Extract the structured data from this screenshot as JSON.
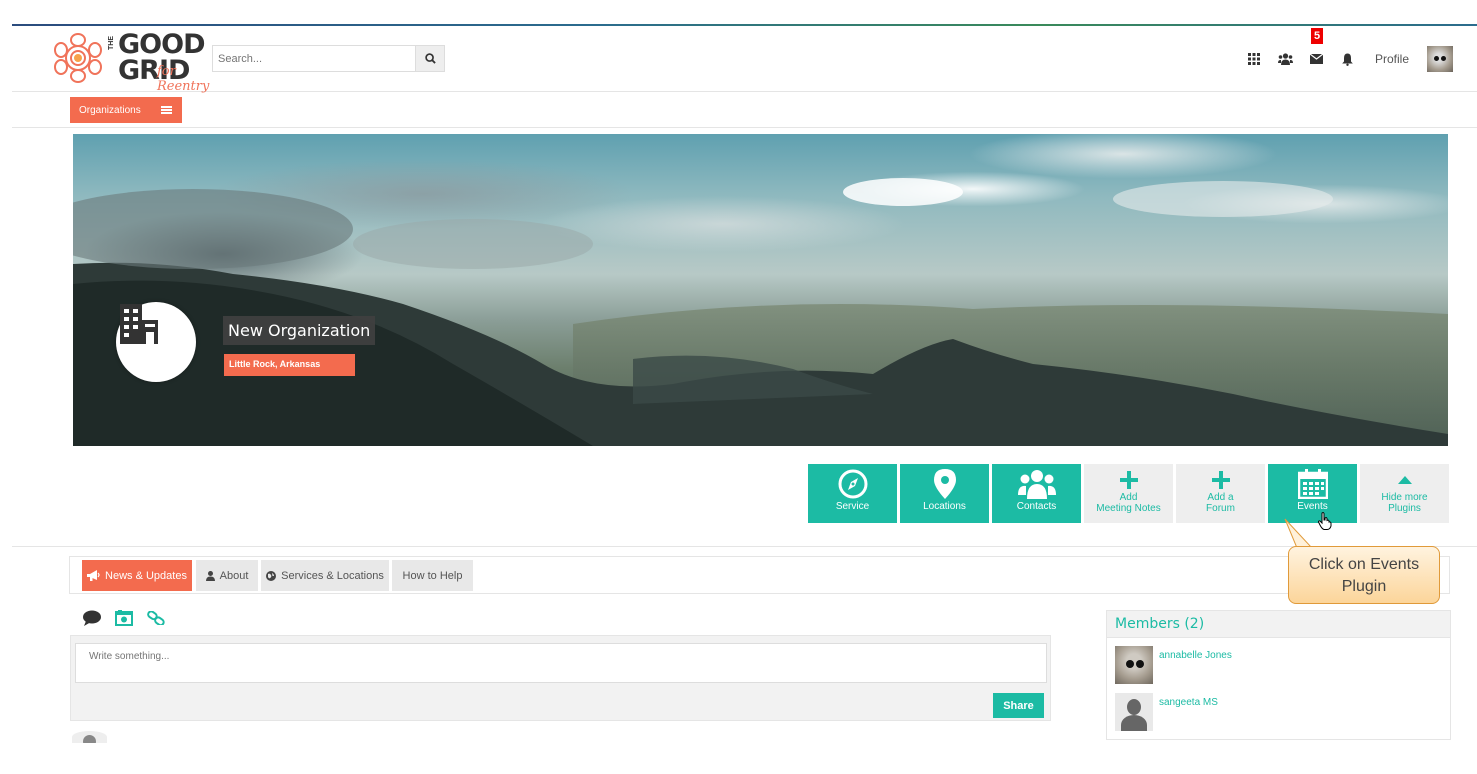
{
  "app": {
    "logo_text_line1": "GOOD",
    "logo_text_line2": "GRID",
    "logo_the": "THE",
    "logo_script": "for Reentry"
  },
  "search": {
    "placeholder": "Search...",
    "icon": "search-icon"
  },
  "topnav": {
    "icons": [
      "apps-grid-icon",
      "users-icon",
      "envelope-icon",
      "bell-icon"
    ],
    "mail_badge": "5",
    "profile_label": "Profile"
  },
  "subnav": {
    "organizations_label": "Organizations"
  },
  "organization": {
    "name": "New Organization",
    "location": "Little Rock, Arkansas"
  },
  "plugins": [
    {
      "label": "Service",
      "icon": "compass-icon",
      "style": "teal"
    },
    {
      "label": "Locations",
      "icon": "map-marker-icon",
      "style": "teal"
    },
    {
      "label": "Contacts",
      "icon": "users-icon",
      "style": "teal"
    },
    {
      "label": "Add Meeting Notes",
      "line1": "Add",
      "line2": "Meeting Notes",
      "icon": "plus-icon",
      "style": "grey"
    },
    {
      "label": "Add a Forum",
      "line1": "Add a",
      "line2": "Forum",
      "icon": "plus-icon",
      "style": "grey"
    },
    {
      "label": "Events",
      "icon": "calendar-icon",
      "style": "teal"
    },
    {
      "label": "Hide more Plugins",
      "line1": "Hide more",
      "line2": "Plugins",
      "icon": "caret-up-icon",
      "style": "grey"
    }
  ],
  "tabs": [
    {
      "label": "News & Updates",
      "icon": "bullhorn-icon",
      "active": true
    },
    {
      "label": "About",
      "icon": "user-icon",
      "active": false
    },
    {
      "label": "Services & Locations",
      "icon": "globe-icon",
      "active": false
    },
    {
      "label": "How to Help",
      "icon": "",
      "active": false
    }
  ],
  "callout": {
    "line1": "Click on Events",
    "line2": "Plugin"
  },
  "post": {
    "placeholder": "Write something...",
    "share_label": "Share",
    "type_icons": [
      "comment-icon",
      "photo-icon",
      "link-icon"
    ]
  },
  "members": {
    "title": "Members (2)",
    "list": [
      {
        "name": "annabelle Jones"
      },
      {
        "name": "sangeeta MS"
      }
    ]
  },
  "colors": {
    "accent_orange": "#f36b4e",
    "accent_teal": "#1cbba4",
    "badge_red": "#ee0000"
  }
}
